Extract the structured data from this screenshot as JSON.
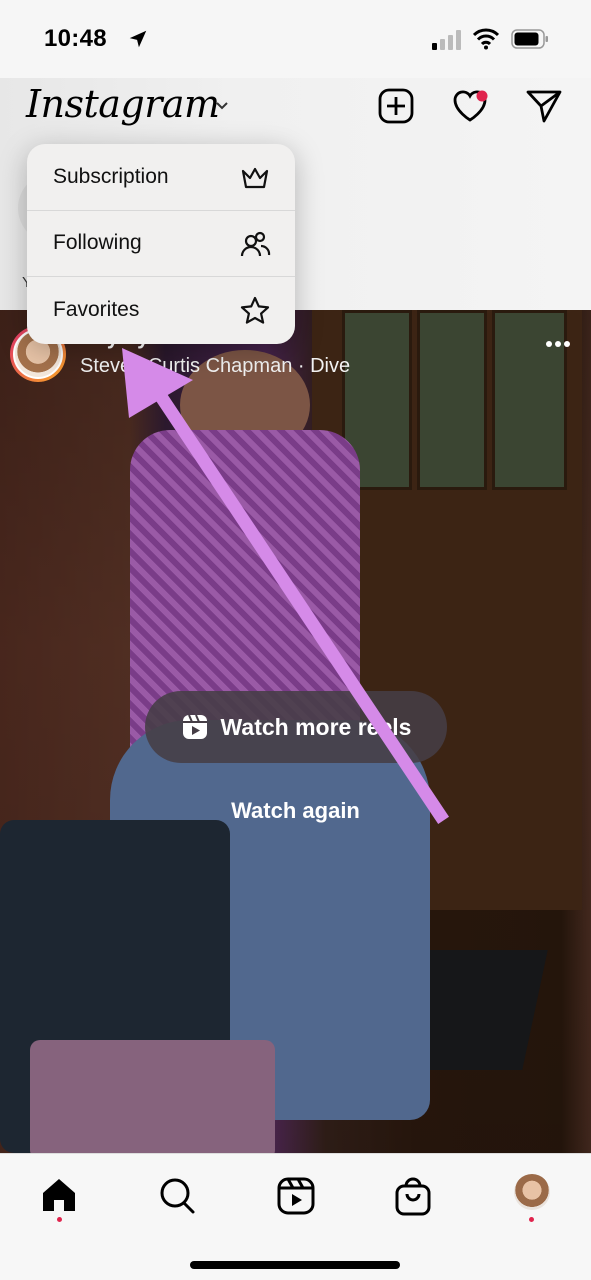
{
  "status_bar": {
    "time": "10:48",
    "location_icon": "location-arrow-icon",
    "signal_icon": "cellular-signal-icon",
    "wifi_icon": "wifi-icon",
    "battery_icon": "battery-icon"
  },
  "header": {
    "logo": "Instagram",
    "logo_dropdown_icon": "chevron-down-icon",
    "actions": [
      {
        "name": "create",
        "icon": "plus-square-icon"
      },
      {
        "name": "activity",
        "icon": "heart-icon",
        "badge": true
      },
      {
        "name": "direct",
        "icon": "paper-plane-icon"
      }
    ],
    "story_label_partial": "Y"
  },
  "feed_menu": {
    "items": [
      {
        "label": "Subscription",
        "icon": "crown-icon"
      },
      {
        "label": "Following",
        "icon": "people-icon"
      },
      {
        "label": "Favorites",
        "icon": "star-icon"
      }
    ]
  },
  "post": {
    "username": "fiftystyleblessed",
    "audio": "Steven Curtis Chapman · Dive",
    "more_icon": "more-horizontal-icon",
    "watch_more_label": "Watch more reels",
    "watch_more_icon": "reels-icon",
    "watch_again_label": "Watch again"
  },
  "annotation": {
    "type": "arrow",
    "color": "#d58ae8",
    "points_to": "feed-menu"
  },
  "tabbar": {
    "tabs": [
      {
        "name": "home",
        "icon": "home-icon",
        "active": true,
        "dot": true
      },
      {
        "name": "search",
        "icon": "search-icon"
      },
      {
        "name": "reels",
        "icon": "reels-icon"
      },
      {
        "name": "shop",
        "icon": "shopping-bag-icon"
      },
      {
        "name": "profile",
        "icon": "profile-avatar",
        "dot": true
      }
    ]
  },
  "colors": {
    "notification": "#e0244d",
    "arrow": "#d58ae8",
    "menu_bg": "#f1f0ef"
  }
}
